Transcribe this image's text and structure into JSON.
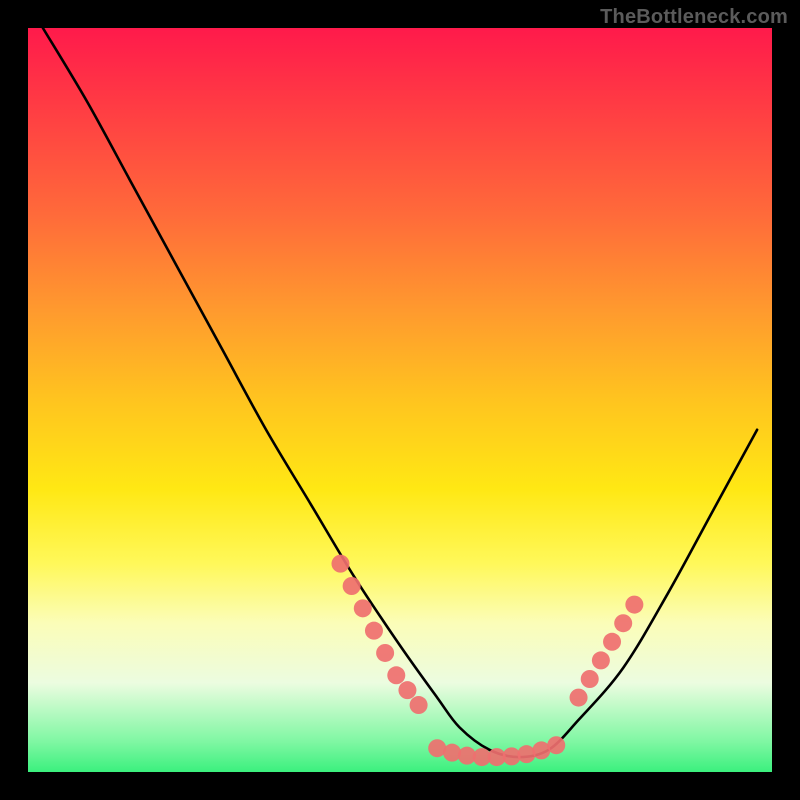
{
  "watermark": "TheBottleneck.com",
  "chart_data": {
    "type": "line",
    "title": "",
    "xlabel": "",
    "ylabel": "",
    "xlim": [
      0,
      100
    ],
    "ylim": [
      0,
      100
    ],
    "grid": false,
    "legend": false,
    "series": [
      {
        "name": "bottleneck-curve",
        "color": "#000000",
        "x": [
          2,
          8,
          14,
          20,
          26,
          32,
          38,
          44,
          50,
          55,
          58,
          62,
          66,
          70,
          74,
          80,
          86,
          92,
          98
        ],
        "y": [
          100,
          90,
          79,
          68,
          57,
          46,
          36,
          26,
          17,
          10,
          6,
          3,
          2,
          3,
          7,
          14,
          24,
          35,
          46
        ]
      },
      {
        "name": "left-dots",
        "color": "#ef6f6f",
        "type": "scatter",
        "x": [
          42,
          43.5,
          45,
          46.5,
          48,
          49.5,
          51,
          52.5
        ],
        "y": [
          28,
          25,
          22,
          19,
          16,
          13,
          11,
          9
        ]
      },
      {
        "name": "bottom-dots",
        "color": "#ef6f6f",
        "type": "scatter",
        "x": [
          55,
          57,
          59,
          61,
          63,
          65,
          67,
          69,
          71
        ],
        "y": [
          3.2,
          2.6,
          2.2,
          2.0,
          2.0,
          2.1,
          2.4,
          2.9,
          3.6
        ]
      },
      {
        "name": "right-dots",
        "color": "#ef6f6f",
        "type": "scatter",
        "x": [
          74,
          75.5,
          77,
          78.5,
          80,
          81.5
        ],
        "y": [
          10,
          12.5,
          15,
          17.5,
          20,
          22.5
        ]
      }
    ]
  }
}
